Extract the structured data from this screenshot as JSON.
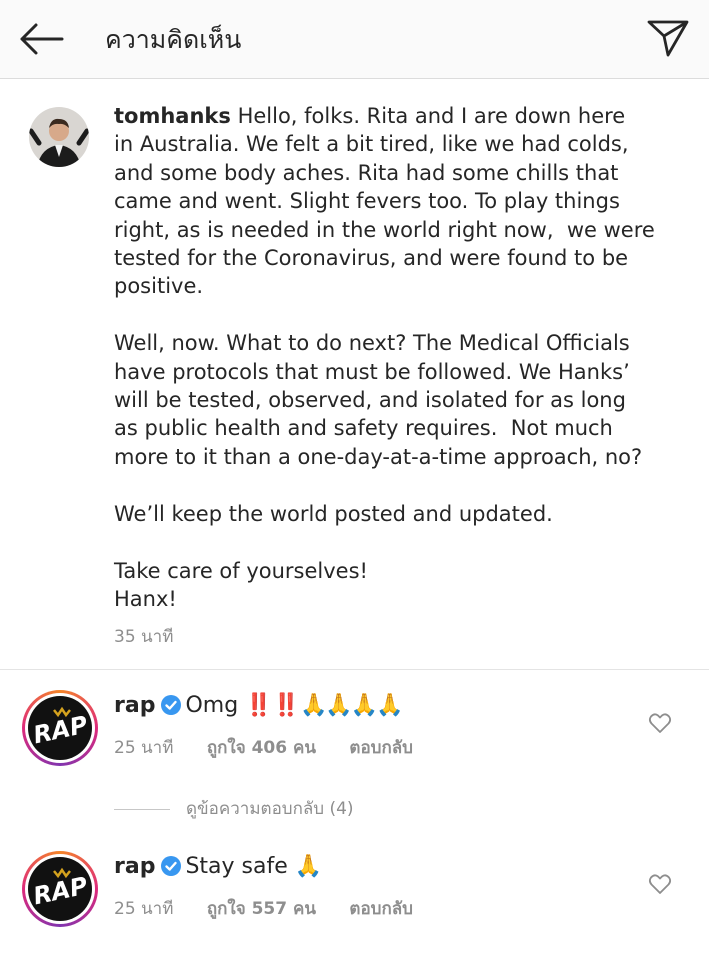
{
  "header": {
    "title": "ความคิดเห็น",
    "back_icon": "arrow-left-icon",
    "send_icon": "paper-plane-icon"
  },
  "caption": {
    "username": "tomhanks",
    "text": " Hello, folks. Rita and I are down here\nin Australia. We felt a bit tired, like we had colds,\nand some body aches. Rita had some chills that\ncame and went. Slight fevers too. To play things\nright, as is needed in the world right now,  we were\ntested for the Coronavirus, and were found to be\npositive.\n\nWell, now. What to do next? The Medical Officials\nhave protocols that must be followed. We Hanks’\nwill be tested, observed, and isolated for as long\nas public health and safety requires.  Not much\nmore to it than a one-day-at-a-time approach, no?\n\nWe’ll keep the world posted and updated.\n\nTake care of yourselves!\nHanx!",
    "time": "35 นาที"
  },
  "comments": [
    {
      "username": "rap",
      "text": "Omg ",
      "emphasis": "‼️‼️",
      "emoji": "🙏🙏🙏🙏",
      "time": "25 นาที",
      "likes": "ถูกใจ 406 คน",
      "reply": "ตอบกลับ"
    },
    {
      "username": "rap",
      "text": "Stay safe ",
      "emoji": "🙏",
      "time": "25 นาที",
      "likes": "ถูกใจ 557 คน",
      "reply": "ตอบกลับ"
    }
  ],
  "view_replies": "ดูข้อความตอบกลับ (4)",
  "colors": {
    "verified": "#3897f0",
    "muted": "#8e8e8e",
    "accent_red": "#e0262b"
  }
}
